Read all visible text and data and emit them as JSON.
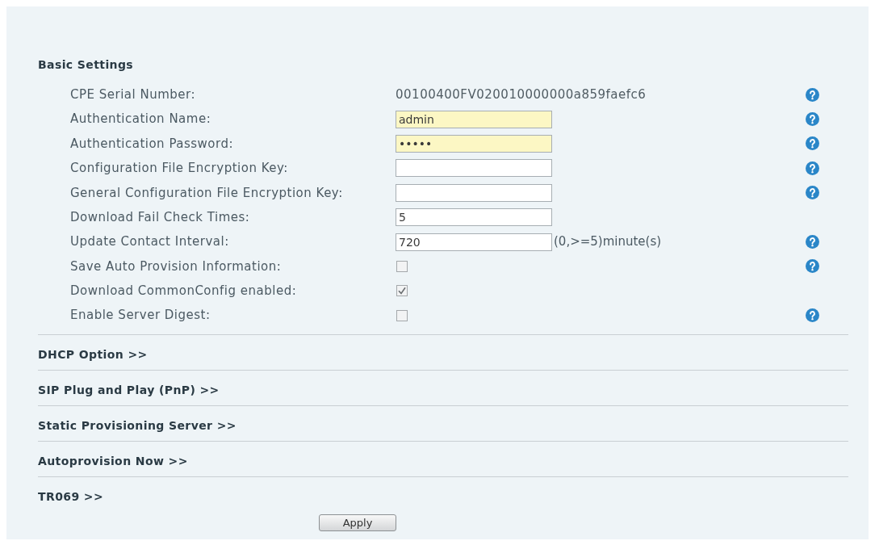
{
  "section": {
    "title": "Basic Settings"
  },
  "fields": [
    {
      "kind": "text",
      "label": "CPE Serial Number:",
      "value": "00100400FV020010000000a859faefc6",
      "help": true
    },
    {
      "kind": "input",
      "label": "Authentication Name:",
      "value": "admin",
      "autofilled": true,
      "help": true
    },
    {
      "kind": "input",
      "label": "Authentication Password:",
      "value": "•••••",
      "autofilled": true,
      "help": true
    },
    {
      "kind": "input",
      "label": "Configuration File Encryption Key:",
      "autofilled": false,
      "help": true
    },
    {
      "kind": "input",
      "label": "General Configuration File Encryption Key:",
      "autofilled": false,
      "help": true
    },
    {
      "kind": "input",
      "label": "Download Fail Check Times:",
      "value": "5",
      "autofilled": false,
      "help": false
    },
    {
      "kind": "input",
      "label": "Update Contact Interval:",
      "value": "720",
      "suffix": "(0,>=5)minute(s)",
      "autofilled": false,
      "help": true
    },
    {
      "kind": "checkbox",
      "label": "Save Auto Provision Information:",
      "checked": false,
      "help": true
    },
    {
      "kind": "checkbox",
      "label": "Download CommonConfig enabled:",
      "checked": true,
      "help": false
    },
    {
      "kind": "checkbox",
      "label": "Enable Server Digest:",
      "checked": false,
      "help": true
    }
  ],
  "collapsed_sections": [
    {
      "title": "DHCP Option >>"
    },
    {
      "title": "SIP Plug and Play (PnP) >>"
    },
    {
      "title": "Static Provisioning Server >>"
    },
    {
      "title": "Autoprovision Now >>"
    },
    {
      "title": "TR069 >>"
    }
  ],
  "apply_button": "Apply"
}
